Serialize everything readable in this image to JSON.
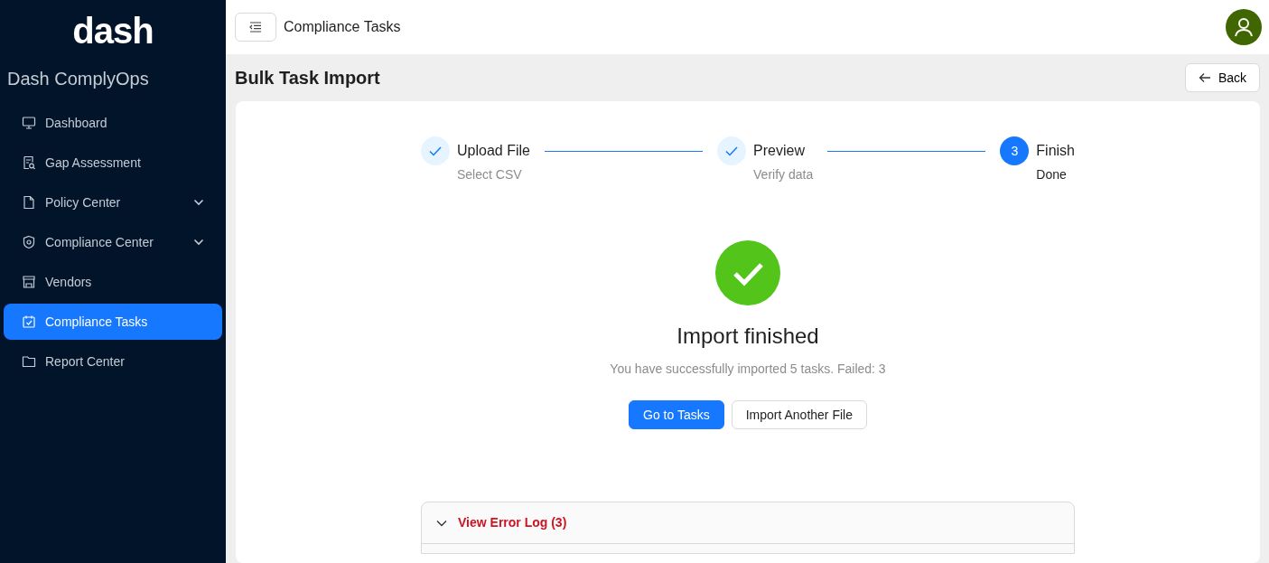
{
  "sidebar": {
    "logo": "dash",
    "app_name": "Dash ComplyOps",
    "items": [
      {
        "label": "Dashboard",
        "selected": false,
        "expandable": false
      },
      {
        "label": "Gap Assessment",
        "selected": false,
        "expandable": false
      },
      {
        "label": "Policy Center",
        "selected": false,
        "expandable": true
      },
      {
        "label": "Compliance Center",
        "selected": false,
        "expandable": true
      },
      {
        "label": "Vendors",
        "selected": false,
        "expandable": false
      },
      {
        "label": "Compliance Tasks",
        "selected": true,
        "expandable": false
      },
      {
        "label": "Report Center",
        "selected": false,
        "expandable": false
      }
    ]
  },
  "topbar": {
    "title": "Compliance Tasks"
  },
  "page": {
    "title": "Bulk Task Import",
    "back": "Back"
  },
  "steps": [
    {
      "label": "Upload File",
      "sub": "Select CSV",
      "completed": true,
      "selected": false
    },
    {
      "label": "Preview",
      "sub": "Verify data",
      "completed": true,
      "selected": false
    },
    {
      "label": "Finish",
      "sub": "Done",
      "completed": false,
      "selected": true,
      "number": "3"
    }
  ],
  "result": {
    "kind": "success",
    "title": "Import finished",
    "message": "You have successfully imported 5 tasks. Failed: 3",
    "buttons": [
      {
        "label": "Go to Tasks",
        "kind": "primary"
      },
      {
        "label": "Import Another File",
        "kind": "secondary"
      }
    ]
  },
  "error_log": {
    "label": "View Error Log (3)",
    "expanded": true
  }
}
